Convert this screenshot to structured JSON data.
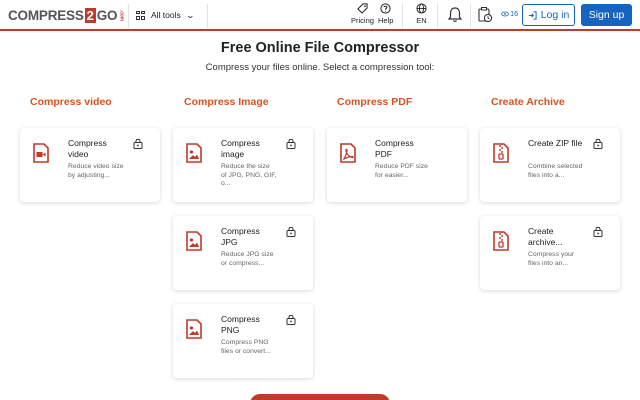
{
  "header": {
    "logo": {
      "part1": "COMPRESS",
      "part2": "2",
      "part3": "GO",
      "part4": ".com"
    },
    "all_tools_label": "All tools",
    "pricing_label": "Pricing",
    "help_label": "Help",
    "language_label": "EN",
    "history_count": "16",
    "login_label": "Log in",
    "signup_label": "Sign up"
  },
  "main": {
    "title": "Free Online File Compressor",
    "subtitle": "Compress your files online. Select a compression tool:"
  },
  "columns": [
    {
      "title": "Compress video",
      "cards": [
        {
          "title": "Compress video",
          "desc": "Reduce video size by adjusting...",
          "icon": "video-file-icon"
        }
      ]
    },
    {
      "title": "Compress Image",
      "cards": [
        {
          "title": "Compress image",
          "desc": "Reduce the size of JPG, PNG, GIF, o...",
          "icon": "image-file-icon"
        },
        {
          "title": "Compress JPG",
          "desc": "Reduce JPG size or compress...",
          "icon": "image-file-icon"
        },
        {
          "title": "Compress PNG",
          "desc": "Compress PNG files or convert...",
          "icon": "image-file-icon"
        }
      ]
    },
    {
      "title": "Compress PDF",
      "cards": [
        {
          "title": "Compress PDF",
          "desc": "Reduce PDF size for easier...",
          "icon": "pdf-file-icon"
        }
      ]
    },
    {
      "title": "Create Archive",
      "cards": [
        {
          "title": "Create ZIP file",
          "desc": "Combine selected files into a...",
          "icon": "zip-file-icon"
        },
        {
          "title": "Create archive...",
          "desc": "Compress your files into an...",
          "icon": "zip-file-icon"
        }
      ]
    }
  ],
  "colors": {
    "brand": "#c0392b",
    "accent_orange": "#d9531e",
    "primary_blue": "#1565c0"
  }
}
